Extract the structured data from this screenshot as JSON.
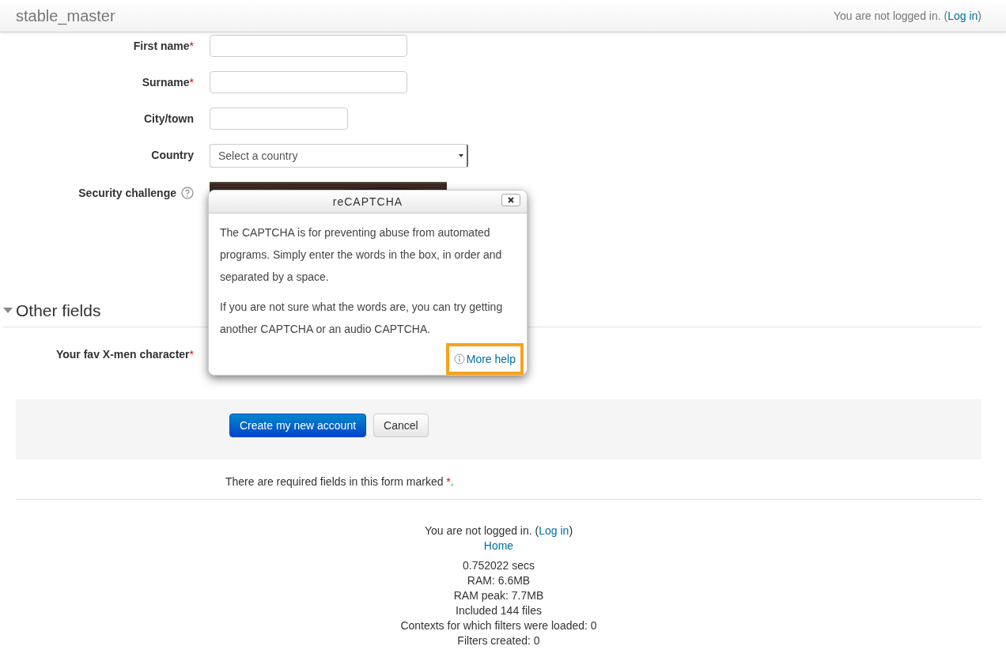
{
  "navbar": {
    "site_name": "stable_master",
    "login_text": "You are not logged in.",
    "paren_open": "(",
    "login_link": "Log in",
    "paren_close": ")"
  },
  "fields": [
    {
      "label": "First name",
      "required": true,
      "kind": "text"
    },
    {
      "label": "Surname",
      "required": true,
      "kind": "text"
    },
    {
      "label": "City/town",
      "kind": "short"
    },
    {
      "label": "Country",
      "kind": "select",
      "placeholder": "Select a country"
    },
    {
      "label": "Security challenge",
      "kind": "captcha"
    }
  ],
  "section": {
    "title": "Other fields",
    "expanded": true,
    "fields": [
      {
        "label": "Your fav X-men character",
        "required": true
      }
    ]
  },
  "buttons": [
    {
      "label": "Create my new account",
      "kind": "primary"
    },
    {
      "label": "Cancel",
      "kind": "default"
    }
  ],
  "required_note": {
    "text": "There are required fields in this form marked",
    "mark": "*",
    "end": "."
  },
  "popup": {
    "title": "reCAPTCHA",
    "paragraphs": [
      "The CAPTCHA is for preventing abuse from automated programs. Simply enter the words in the box, in order and separated by a space.",
      "If you are not sure what the words are, you can try getting another CAPTCHA or an audio CAPTCHA."
    ],
    "help_link": "More help",
    "highlighted": true
  },
  "footer": {
    "login_text": "You are not logged in.",
    "paren_open": "(",
    "login_link": "Log in",
    "paren_close": ")",
    "home_link": "Home",
    "stats": [
      "0.752022 secs",
      "RAM: 6.6MB",
      "RAM peak: 7.7MB",
      "Included 144 files",
      "Contexts for which filters were loaded: 0",
      "Filters created: 0"
    ]
  }
}
